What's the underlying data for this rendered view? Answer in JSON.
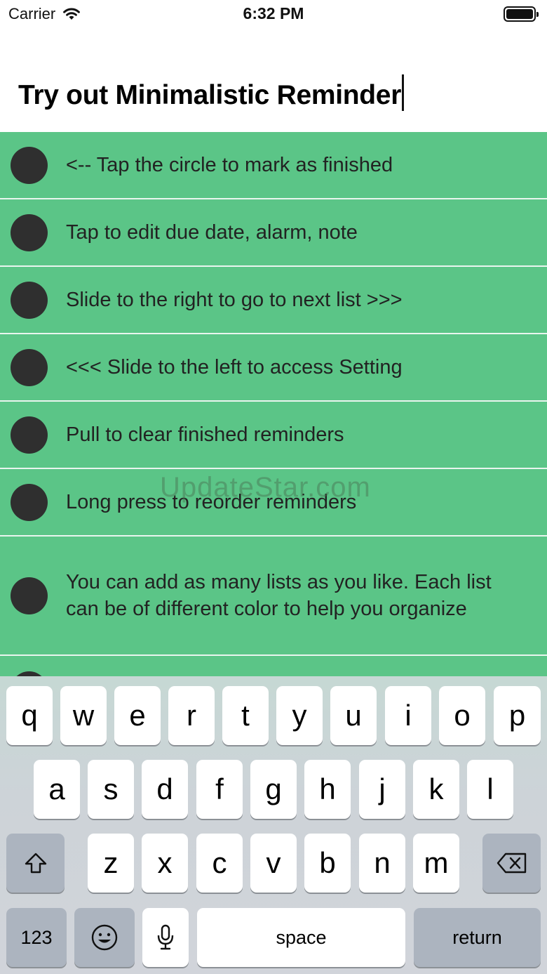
{
  "status_bar": {
    "carrier": "Carrier",
    "time": "6:32 PM",
    "wifi_icon": "wifi-icon",
    "battery_icon": "battery-full-icon"
  },
  "list_title": "Try out Minimalistic Reminder",
  "reminders": [
    {
      "text": "<-- Tap the circle to mark as finished"
    },
    {
      "text": "Tap to edit due date, alarm, note"
    },
    {
      "text": "Slide to the right to go to next list >>>"
    },
    {
      "text": "<<< Slide to the left to access Setting"
    },
    {
      "text": "Pull to clear finished reminders"
    },
    {
      "text": "Long press to reorder reminders"
    },
    {
      "text": "You can add as many lists as you like. Each list can be of different color to help you organize"
    }
  ],
  "watermark": "UpdateStar.com",
  "colors": {
    "list_background": "#5bc587",
    "circle": "#2f2f2f",
    "separator": "#e9f5ee"
  },
  "keyboard": {
    "row1": [
      "q",
      "w",
      "e",
      "r",
      "t",
      "y",
      "u",
      "i",
      "o",
      "p"
    ],
    "row2": [
      "a",
      "s",
      "d",
      "f",
      "g",
      "h",
      "j",
      "k",
      "l"
    ],
    "row3": [
      "z",
      "x",
      "c",
      "v",
      "b",
      "n",
      "m"
    ],
    "numbers_label": "123",
    "space_label": "space",
    "return_label": "return",
    "shift_icon": "shift-icon",
    "delete_icon": "delete-icon",
    "emoji_icon": "emoji-icon",
    "mic_icon": "microphone-icon"
  }
}
